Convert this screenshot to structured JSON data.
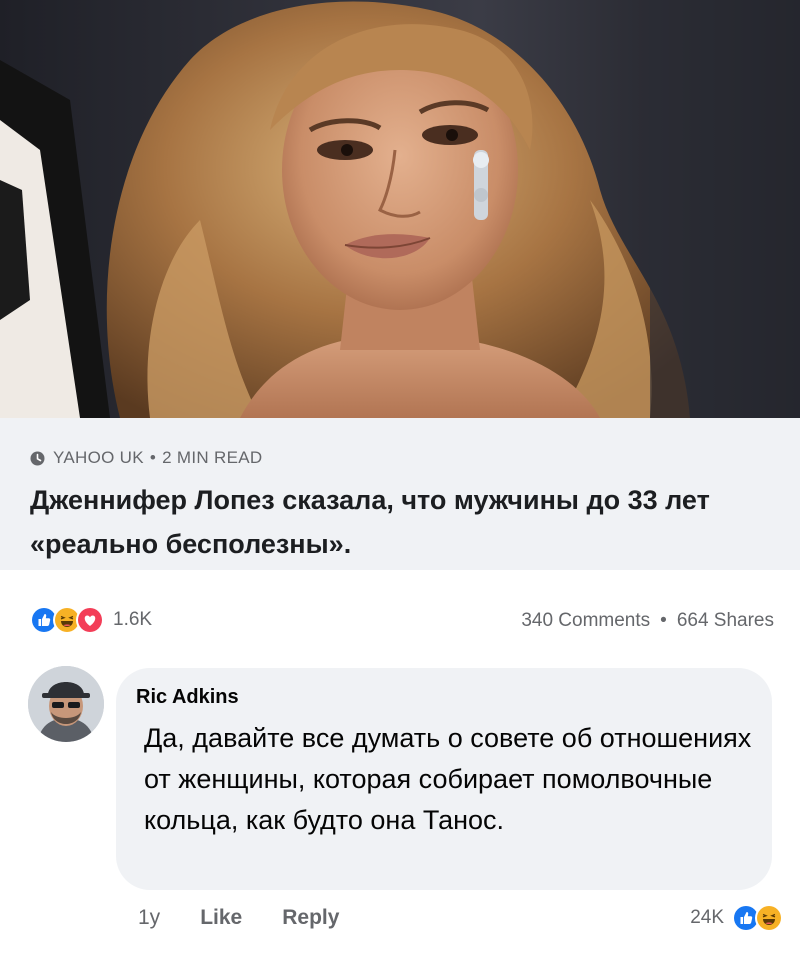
{
  "post": {
    "hero_image": "photo of Jennifer Lopez with wavy honey-blonde hair",
    "source_icon": "clock-icon",
    "source_name": "YAHOO UK",
    "separator": "•",
    "read_time": "2 MIN READ",
    "headline": "Дженнифер Лопез сказала, что мужчины до 33 лет «реально бесполезны»."
  },
  "stats": {
    "reactions": [
      "like-reaction-icon",
      "haha-reaction-icon",
      "love-reaction-icon"
    ],
    "reaction_count": "1.6K",
    "comments": "340 Comments",
    "separator": "•",
    "shares": "664 Shares"
  },
  "comment": {
    "avatar": "profile photo of bearded man in cap and sunglasses",
    "author": "Ric Adkins",
    "text": "Да, давайте все думать о совете об отношениях от женщины, которая собирает помолвочные кольца, как будто она Танос.",
    "time": "1y",
    "like_label": "Like",
    "reply_label": "Reply",
    "reaction_count": "24K",
    "reactions": [
      "like-reaction-icon",
      "haha-reaction-icon"
    ]
  },
  "colors": {
    "facebook_blue": "#1877f2",
    "love_red": "#f33e58",
    "haha_yellow": "#f7b125",
    "secondary_text": "#65676b",
    "bubble_bg": "#f0f2f5"
  }
}
